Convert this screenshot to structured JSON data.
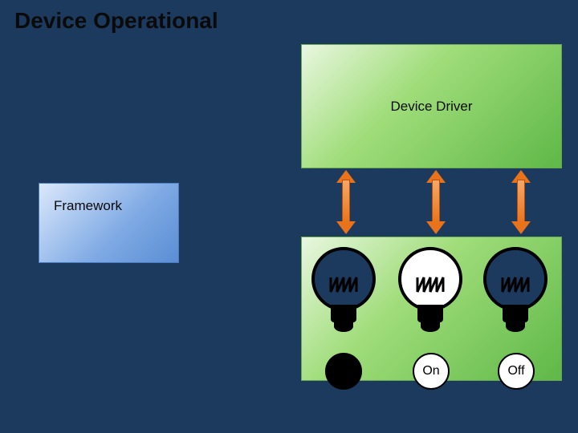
{
  "title": "Device Operational",
  "driver": {
    "label": "Device Driver"
  },
  "framework": {
    "label": "Framework"
  },
  "bulbs": [
    {
      "state": "off"
    },
    {
      "state": "on"
    },
    {
      "state": "off"
    }
  ],
  "status": {
    "on_label": "On",
    "off_label": "Off"
  }
}
